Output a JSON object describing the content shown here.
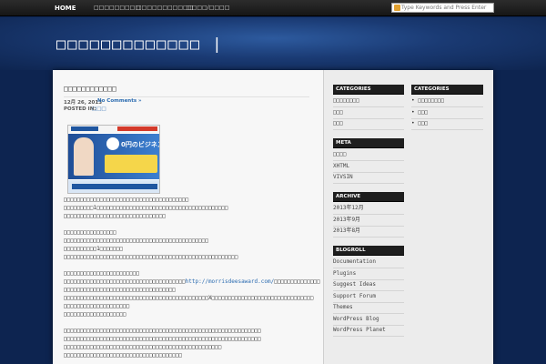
{
  "nav": {
    "home": "HOME",
    "item1": "□□□□□□□□□",
    "item2": "□□□□□□□□□□□",
    "item3": "□□□□/□□□□",
    "search_placeholder": "Type Keywords and Press Enter"
  },
  "header": {
    "site_title": "□□□□□□□□□□□□□ |"
  },
  "post": {
    "title": "□□□□□□□□□□□□",
    "date": "12月 26, 2013",
    "comments": "No Comments »",
    "posted_in_label": "POSTED IN:",
    "category": "□□□",
    "ad_headline": "0円のビジネスホン",
    "lines": [
      "□□□□□□□□□□□□□□□□□□□□□□□□□□□□□□□□□□□□□□",
      "□□□□□□□□□1□□□□□□□□□□□□□□□□□□□□□□□□□□□□□□□□□□□□□□□□",
      "□□□□□□□□□□□□□□□□□□□□□□□□□□□□□□□",
      "",
      "□□□□□□□□□□□□□□□□",
      "□□□□□□□□□□□□□□□□□□□□□□□□□□□□□□□□□□□□□□□□□□□□",
      "□□□□□□□□□□1□□□□□□□",
      "□□□□□□□□□□□□□□□□□□□□□□□□□□□□□□□□□□□□□□□□□□□□□□□□□□□□□",
      "",
      "□□□□□□□□□□□□□□□□□□□□□□□",
      "□□□□□□□□□□□□□□□□□□□□□□□□□□□□□□□□□□□□□□□□",
      "□□□□□□□□□□□□□□□□□□□□□□□□□□□□□□□□□□",
      "□□□□□□□□□□□□□□□□□□□□□□□□□□□□□□□□□□□□□□□□□□□□X□□□□□□□□□□□□□□□□□□□□□□□□□□□□□□□",
      "□□□□□□□□□□□□□□□□□□□□",
      "□□□□□□□□□□□□□□□□□□□",
      "",
      "□□□□□□□□□□□□□□□□□□□□□□□□□□□□□□□□□□□□□□□□□□□□□□□□□□□□□□□□□□□□",
      "□□□□□□□□□□□□□□□□□□□□□□□□□□□□□□□□□□□□□□□□□□□□□□□□□□□□□□□□□□□□",
      "□□□□□□□□□□□□□□□□□□□□□□□□□□□□□□□□□□□□□□□□□□□□□□□□",
      "□□□□□□□□□□□□□□□□□□□□□□□□□□□□□□□□□□□□"
    ],
    "link_prefix": "□□□□□□□□□□□□□□□□□□□□□□□□□□□□□□□□□□□□□",
    "link_url": "http://morrisdeesaward.com/",
    "link_suffix": "□□□□□□□□□□□□□□"
  },
  "sidebar_left": {
    "categories_title": "CATEGORIES",
    "categories": [
      "□□□□□□□□",
      "□□□",
      "□□□"
    ],
    "meta_title": "META",
    "meta": [
      "□□□□",
      "XHTML",
      "VIVSIN"
    ],
    "archive_title": "ARCHIVE",
    "archive": [
      "2013年12月",
      "2013年9月",
      "2013年8月"
    ],
    "blogroll_title": "BLOGROLL",
    "blogroll": [
      "Documentation",
      "Plugins",
      "Suggest Ideas",
      "Support Forum",
      "Themes",
      "WordPress Blog",
      "WordPress Planet"
    ]
  },
  "sidebar_right": {
    "categories_title": "CATEGORIES",
    "categories": [
      "□□□□□□□□",
      "□□□",
      "□□□"
    ]
  },
  "colors": {
    "background": "#0d2450",
    "link": "#2a6bb0",
    "widget_title_bg": "#1e1e1e"
  }
}
